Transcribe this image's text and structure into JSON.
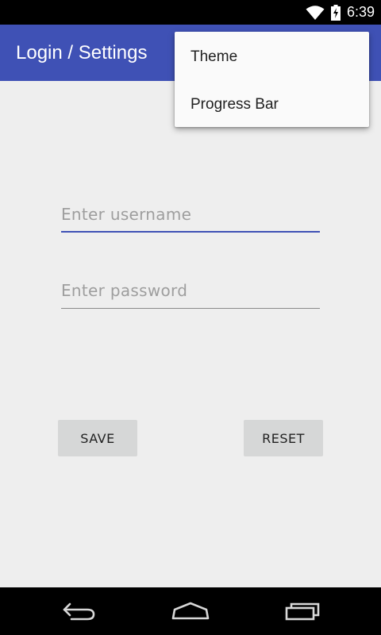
{
  "status_bar": {
    "time": "6:39",
    "wifi_icon": "wifi-icon",
    "battery_icon": "battery-charging-icon"
  },
  "app_bar": {
    "title": "Login / Settings",
    "color": "#3f51b5"
  },
  "overflow_menu": {
    "items": [
      {
        "label": "Theme"
      },
      {
        "label": "Progress Bar"
      }
    ]
  },
  "form": {
    "username": {
      "value": "",
      "placeholder": "Enter username"
    },
    "password": {
      "value": "",
      "placeholder": "Enter password"
    }
  },
  "buttons": {
    "save_label": "SAVE",
    "reset_label": "RESET"
  },
  "nav_bar": {
    "back_icon": "back-icon",
    "home_icon": "home-icon",
    "recents_icon": "recents-icon"
  }
}
